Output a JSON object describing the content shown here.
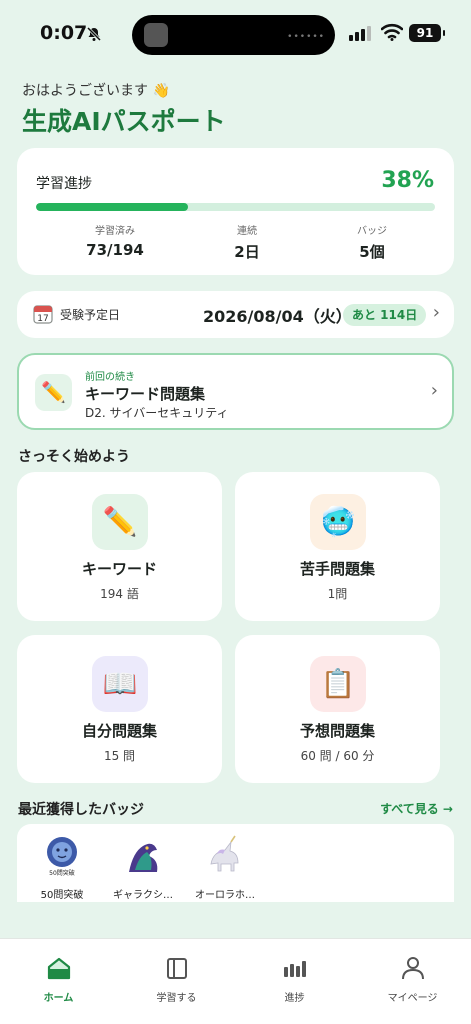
{
  "status_bar": {
    "time": "0:07",
    "battery": "91"
  },
  "header": {
    "greeting": "おはようございます 👋",
    "title": "生成AIパスポート"
  },
  "progress": {
    "label": "学習進捗",
    "percent_text": "38%",
    "percent": 38,
    "stats": [
      {
        "label": "学習済み",
        "value": "73/194"
      },
      {
        "label": "連続",
        "value": "2日"
      },
      {
        "label": "バッジ",
        "value": "5個"
      }
    ]
  },
  "exam": {
    "label": "受験予定日",
    "date": "2026/08/04（火）",
    "remaining": "あと 114日",
    "calendar_day": "17"
  },
  "continue": {
    "tag": "前回の続き",
    "title": "キーワード問題集",
    "subtitle": "D2. サイバーセキュリティ"
  },
  "quick_start": {
    "title": "さっそく始めよう",
    "tiles": [
      {
        "title": "キーワード",
        "sub": "194 語",
        "icon": "pencil-icon"
      },
      {
        "title": "苦手問題集",
        "sub": "1問",
        "icon": "cold-face-icon"
      },
      {
        "title": "自分問題集",
        "sub": "15 問",
        "icon": "book-icon"
      },
      {
        "title": "予想問題集",
        "sub": "60 問 / 60 分",
        "icon": "clipboard-icon"
      }
    ]
  },
  "badges": {
    "title": "最近獲得したバッジ",
    "see_all": "すべて見る →",
    "items": [
      {
        "name": "50問突破",
        "art_text": "50問突破"
      },
      {
        "name": "ギャラクシ…"
      },
      {
        "name": "オーロラホ…"
      }
    ]
  },
  "tabs": [
    {
      "label": "ホーム",
      "icon": "home-icon",
      "active": true
    },
    {
      "label": "学習する",
      "icon": "book-panel-icon",
      "active": false
    },
    {
      "label": "進捗",
      "icon": "bars-icon",
      "active": false
    },
    {
      "label": "マイページ",
      "icon": "person-icon",
      "active": false
    }
  ],
  "colors": {
    "accent": "#22a352",
    "background": "#e6f4ec"
  }
}
